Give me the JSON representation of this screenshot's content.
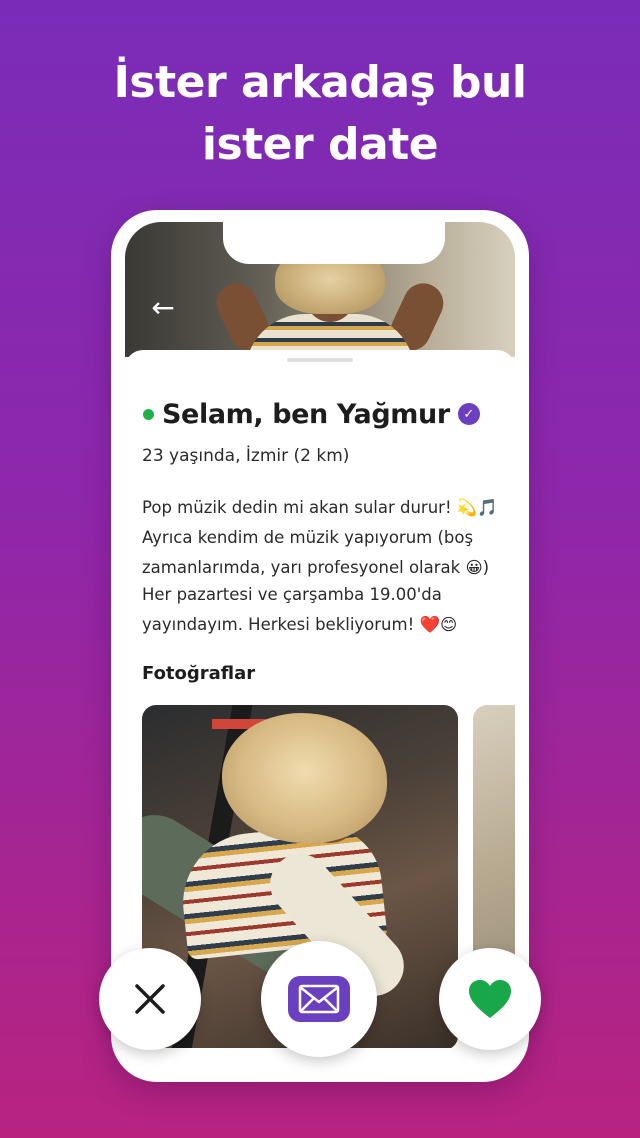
{
  "headline": {
    "line1": "İster arkadaş bul",
    "line2": "ister date"
  },
  "profile": {
    "name": "Selam, ben Yağmur",
    "online": true,
    "verified": true,
    "meta": "23 yaşında, İzmir (2 km)",
    "bio_paragraph_1": [
      "Pop müzik dedin mi akan sular durur! 💫🎵",
      "Ayrıca kendim de müzik yapıyorum (boş",
      "zamanlarımda, yarı profesyonel olarak 😀)"
    ],
    "bio_paragraph_2": [
      "Her pazartesi ve çarşamba 19.00'da",
      "yayındayım. Herkesi bekliyorum! ❤️😊"
    ],
    "photos_title": "Fotoğraflar"
  },
  "actions": {
    "dislike_icon": "close-icon",
    "message_icon": "envelope-icon",
    "like_icon": "heart-icon"
  },
  "colors": {
    "accent": "#6a3fc0",
    "online": "#1fb04a",
    "like": "#18a84a",
    "bg_top": "#7a2cb8",
    "bg_bottom": "#b8237f"
  }
}
